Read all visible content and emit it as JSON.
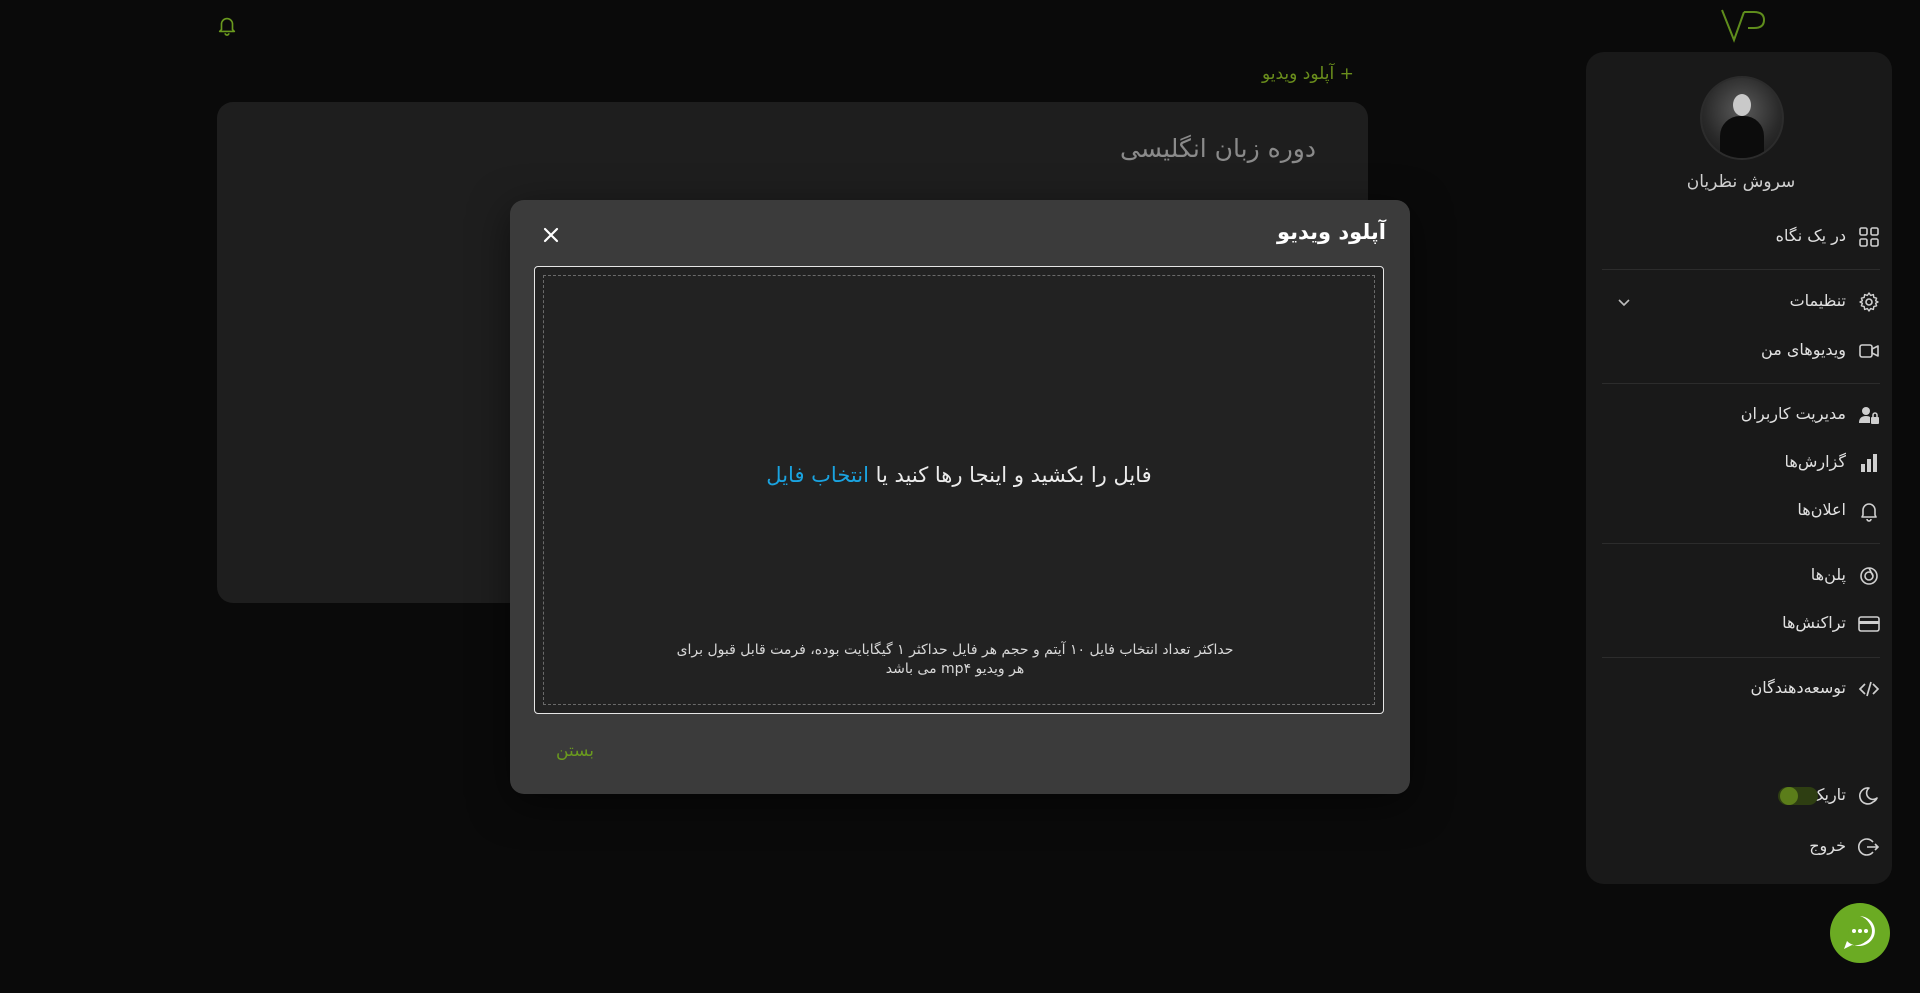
{
  "header": {
    "logo_text": "VP"
  },
  "main": {
    "upload_link": "+ آپلود ویدیو",
    "course_title": "دوره زبان انگلیسی"
  },
  "sidebar": {
    "user_name": "سروش نظریان",
    "items": [
      {
        "label": "در یک نگاه",
        "icon": "grid-icon"
      },
      {
        "label": "تنظیمات",
        "icon": "gear-icon"
      },
      {
        "label": "ویدیوهای من",
        "icon": "video-icon"
      },
      {
        "label": "مدیریت کاربران",
        "icon": "user-lock-icon"
      },
      {
        "label": "گزارش‌ها",
        "icon": "bar-chart-icon"
      },
      {
        "label": "اعلان‌ها",
        "icon": "bell-icon"
      },
      {
        "label": "پلن‌ها",
        "icon": "layers-icon"
      },
      {
        "label": "تراکنش‌ها",
        "icon": "credit-card-icon"
      },
      {
        "label": "توسعه‌دهندگان",
        "icon": "code-icon"
      }
    ],
    "theme_label": "تاریک",
    "logout_label": "خروج"
  },
  "modal": {
    "title": "آپلود ویدیو",
    "drop_text": "فایل را بکشید و اینجا رها کنید یا",
    "pick_file": "انتخاب فایل",
    "hint": "حداکثر تعداد انتخاب فایل ۱۰ آیتم و حجم هر فایل حداکثر ۱ گیگابایت بوده، فرمت قابل قبول برای هر ویدیو mp۴ می باشد",
    "close_label": "بستن"
  },
  "colors": {
    "accent_green": "#6bab23",
    "link_blue": "#1aa3e0",
    "background": "#0a0a0a"
  }
}
